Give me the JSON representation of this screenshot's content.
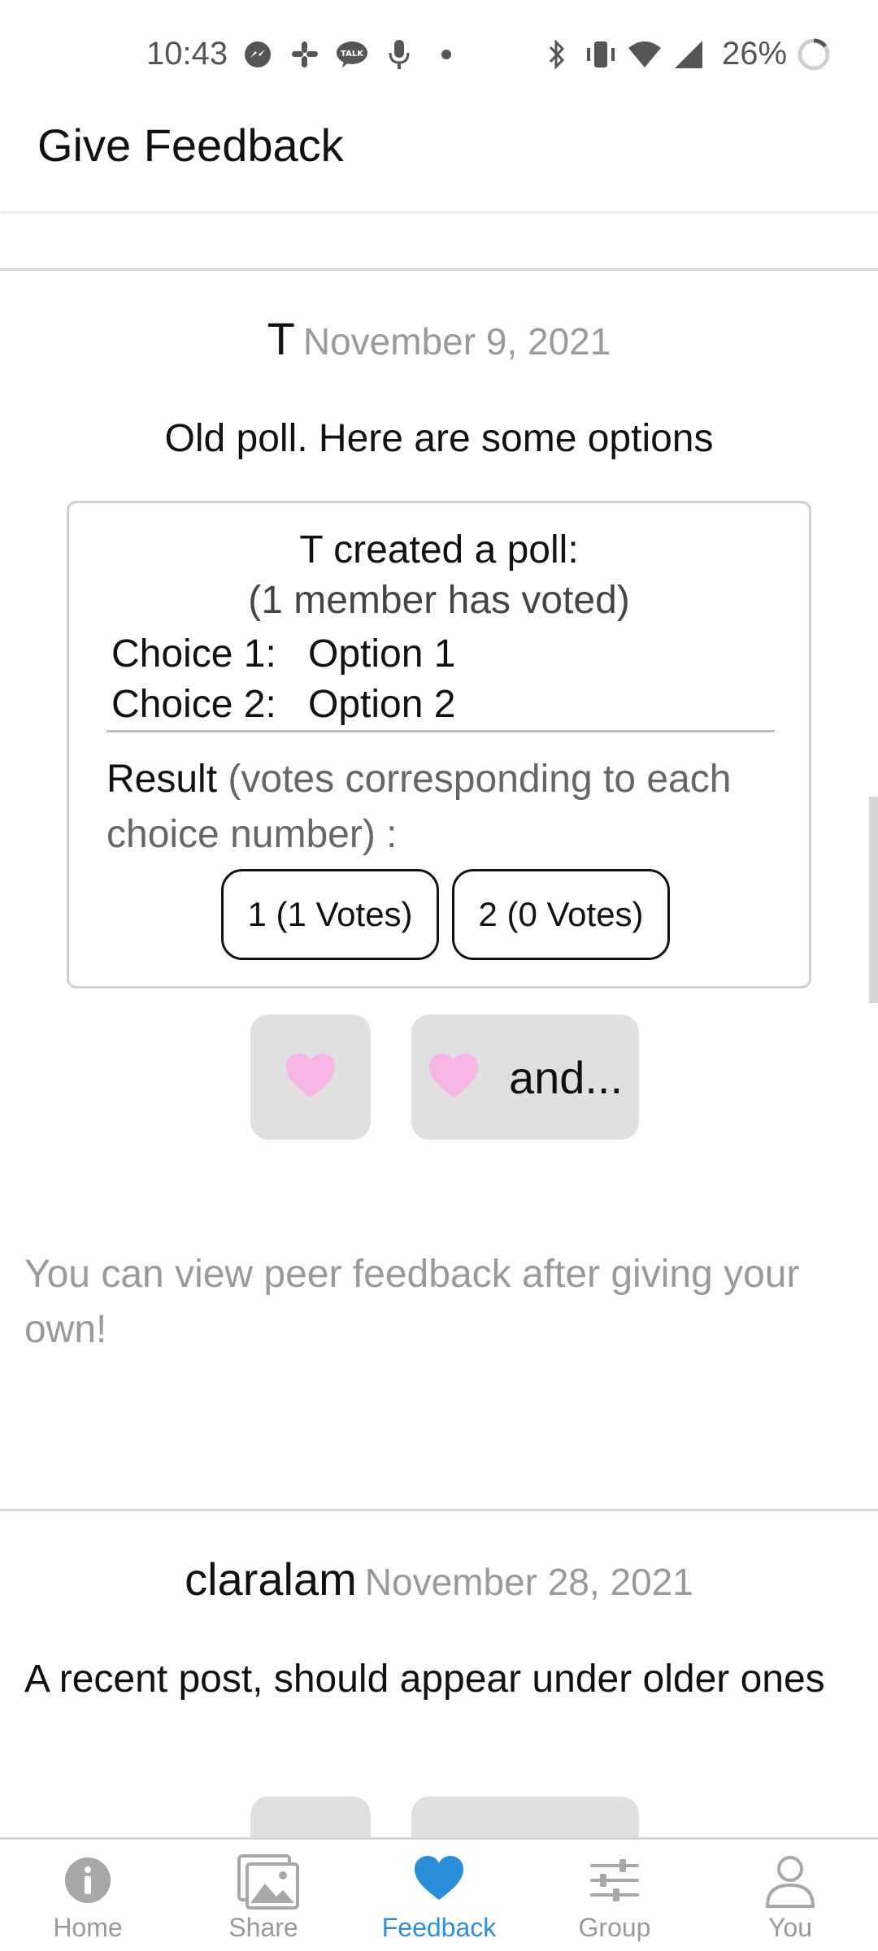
{
  "status_bar": {
    "time": "10:43",
    "battery": "26%",
    "left_icons": [
      "messenger-icon",
      "slack-icon",
      "kakaotalk-icon",
      "microphone-icon",
      "dot-icon"
    ],
    "right_icons": [
      "bluetooth-icon",
      "vibrate-icon",
      "wifi-icon",
      "signal-icon",
      "battery-ring-icon"
    ],
    "kakao_badge": "TALK"
  },
  "header": {
    "title": "Give Feedback"
  },
  "posts": [
    {
      "author": "T",
      "date": "November 9, 2021",
      "body": "Old poll. Here are some options",
      "poll": {
        "heading": "T created a poll:",
        "vote_count": "(1 member has voted)",
        "choices": [
          {
            "label": "Choice 1:",
            "value": "Option 1"
          },
          {
            "label": "Choice 2:",
            "value": "Option 2"
          }
        ],
        "result_label": "Result",
        "result_note": " (votes corresponding to each choice number) :",
        "results": [
          "1 (1 Votes)",
          "2 (0 Votes)"
        ]
      },
      "reactions": [
        {
          "icon": "heart-icon",
          "label": ""
        },
        {
          "icon": "heart-icon",
          "label": "and..."
        }
      ]
    },
    {
      "author": "claralam",
      "date": "November 28, 2021",
      "body": "A recent post, should appear under older ones"
    }
  ],
  "notice": "You can view peer feedback after giving your own!",
  "bottom_nav": [
    {
      "label": "Home",
      "icon": "info-icon",
      "active": false
    },
    {
      "label": "Share",
      "icon": "image-icon",
      "active": false
    },
    {
      "label": "Feedback",
      "icon": "heart-icon",
      "active": true
    },
    {
      "label": "Group",
      "icon": "sliders-icon",
      "active": false
    },
    {
      "label": "You",
      "icon": "person-icon",
      "active": false
    }
  ],
  "colors": {
    "accent": "#2a8fd8",
    "heart_pink": "#f7b6e6",
    "muted_text": "#9a9a9a",
    "reaction_bg": "#e0e0e0"
  }
}
